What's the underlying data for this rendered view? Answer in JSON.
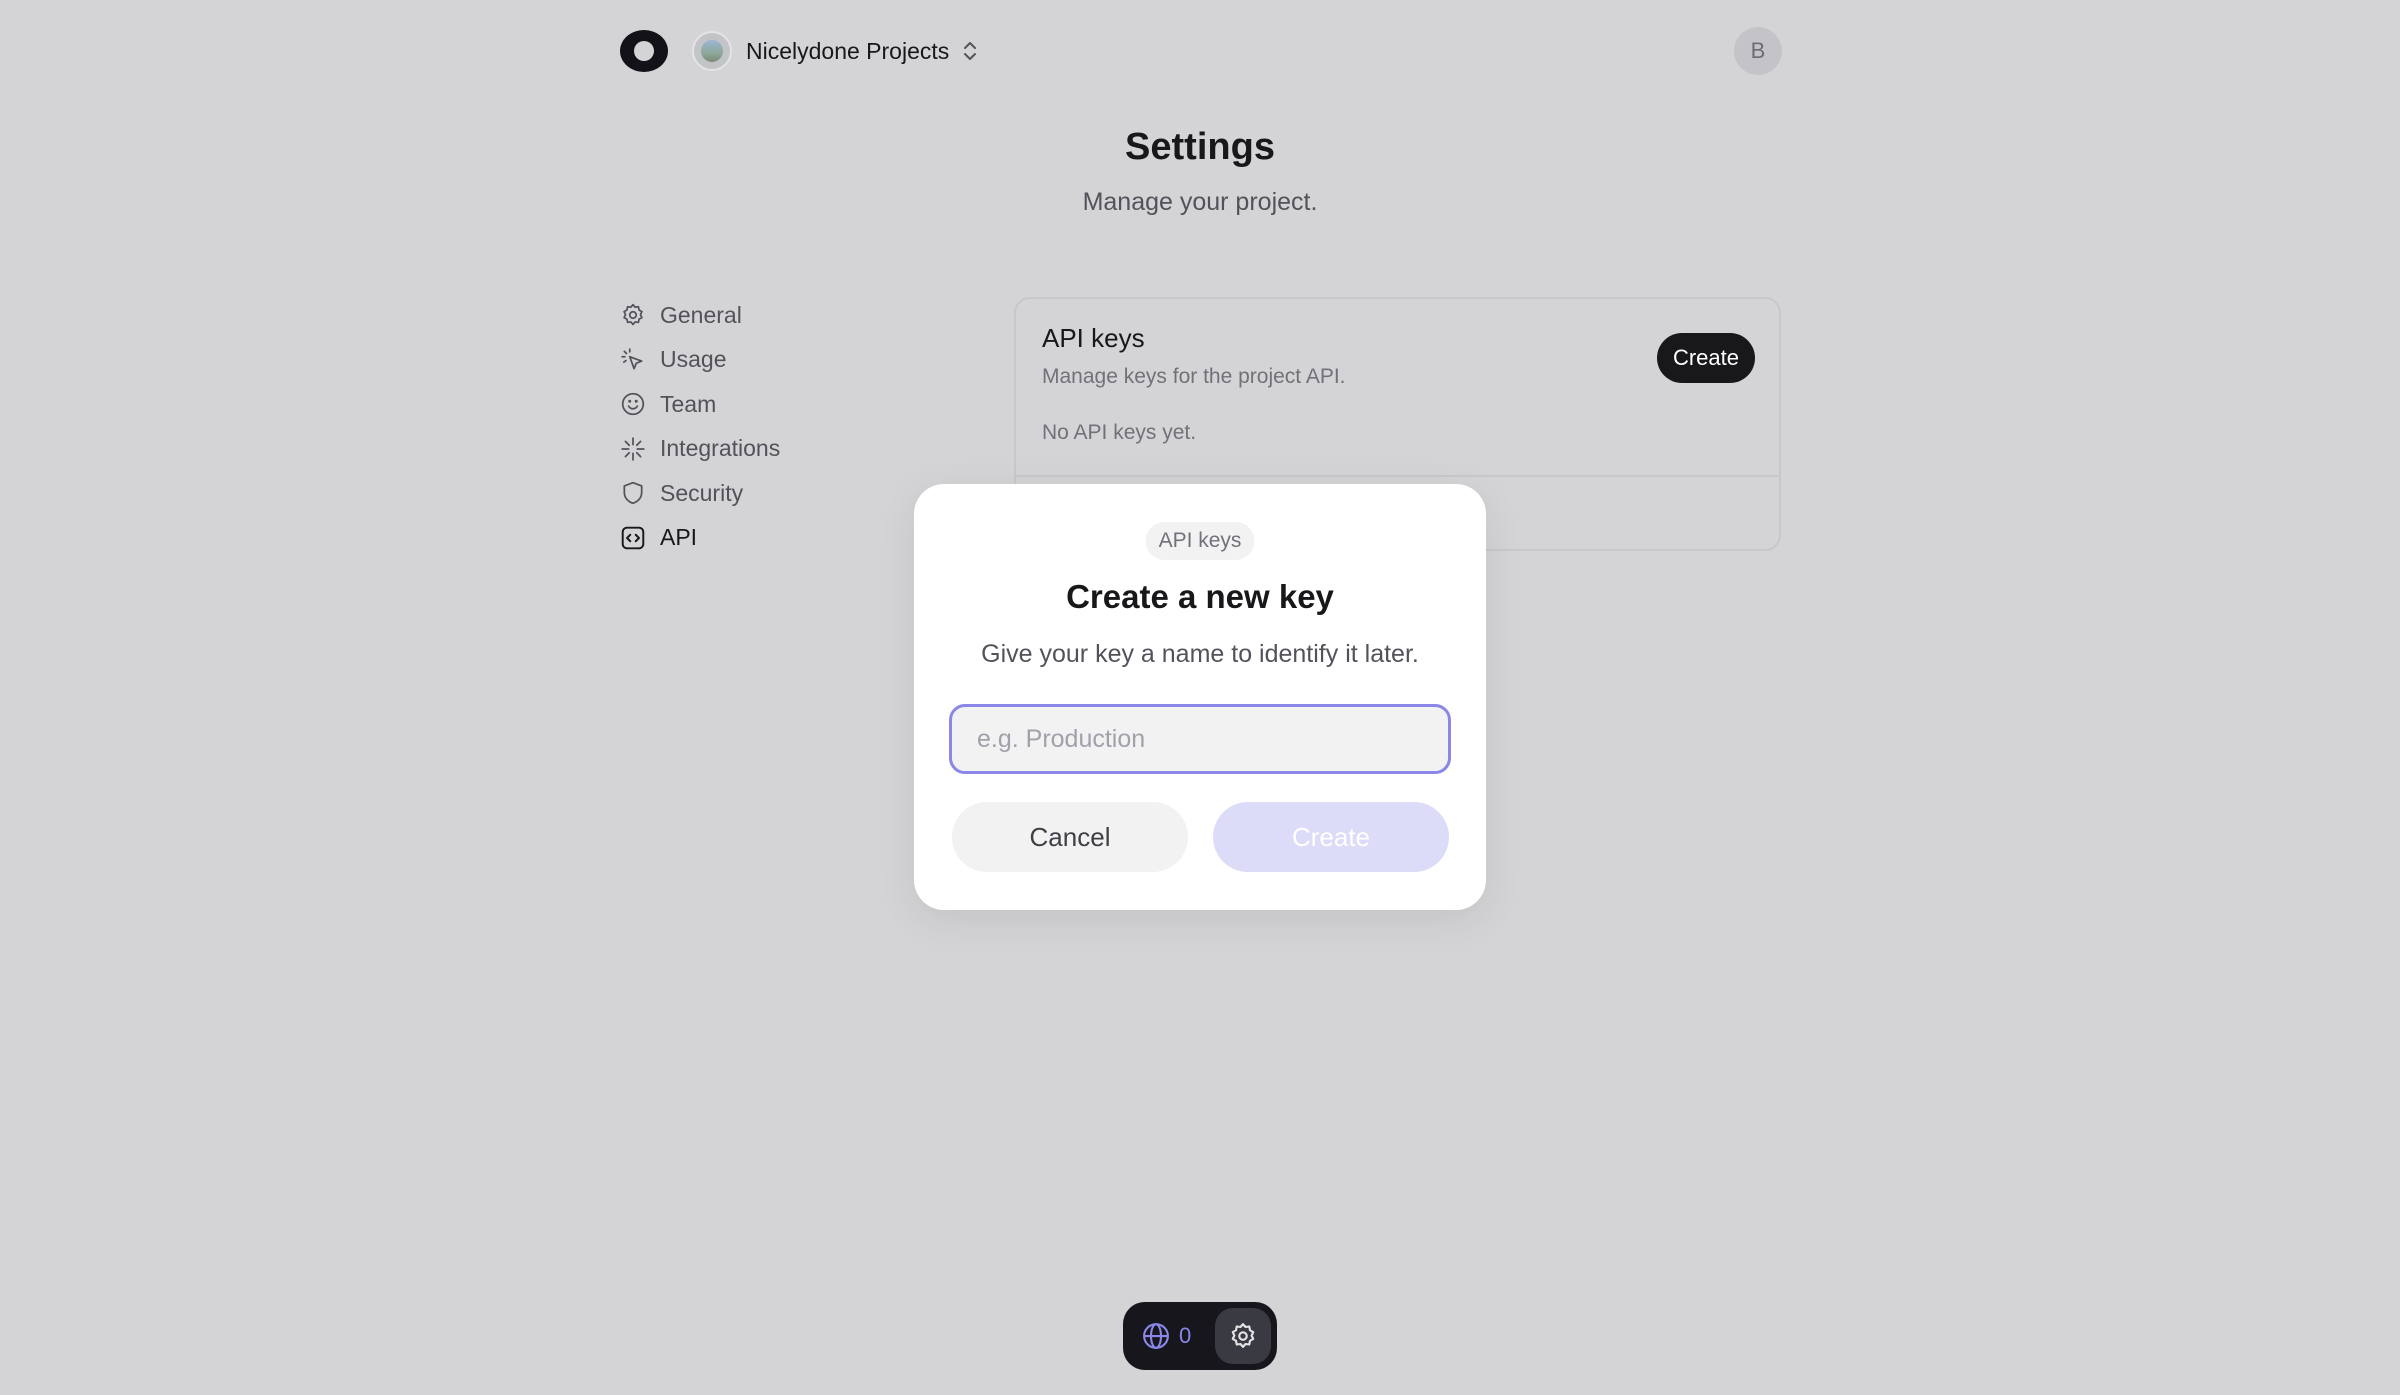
{
  "header": {
    "project_name": "Nicelydone Projects",
    "user_initial": "B"
  },
  "page": {
    "title": "Settings",
    "subtitle": "Manage your project."
  },
  "sidebar": {
    "items": [
      {
        "label": "General",
        "icon": "gear-icon"
      },
      {
        "label": "Usage",
        "icon": "cursor-click-icon"
      },
      {
        "label": "Team",
        "icon": "smiley-icon"
      },
      {
        "label": "Integrations",
        "icon": "sparkle-icon"
      },
      {
        "label": "Security",
        "icon": "shield-icon"
      },
      {
        "label": "API",
        "icon": "code-icon"
      }
    ],
    "active": "API"
  },
  "api_card": {
    "title": "API keys",
    "description": "Manage keys for the project API.",
    "empty_text": "No API keys yet.",
    "create_label": "Create"
  },
  "modal": {
    "pill": "API keys",
    "title": "Create a new key",
    "description": "Give your key a name to identify it later.",
    "input_placeholder": "e.g. Production",
    "input_value": "",
    "cancel_label": "Cancel",
    "create_label": "Create"
  },
  "dock": {
    "count": "0"
  },
  "colors": {
    "background": "#d4d4d6",
    "accent": "#8b87e8",
    "dark": "#18181b"
  }
}
